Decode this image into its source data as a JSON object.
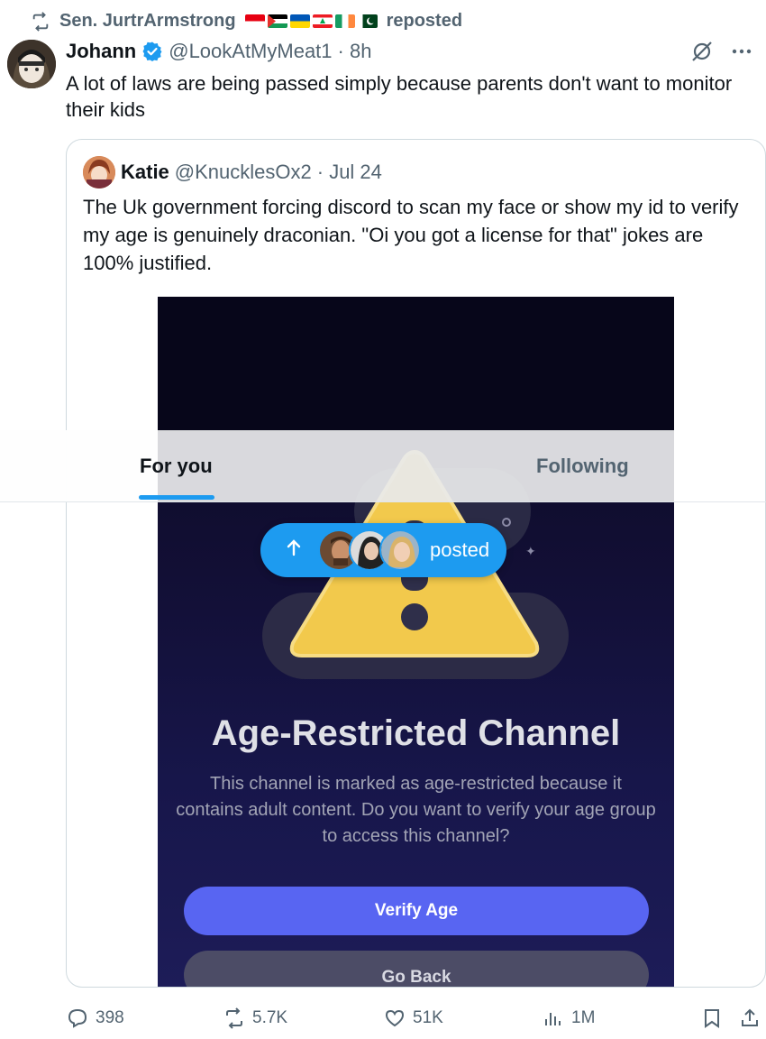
{
  "repost": {
    "by": "Sen. JurtrArmstrong",
    "suffix": "reposted"
  },
  "tweet": {
    "author_name": "Johann",
    "handle": "@LookAtMyMeat1",
    "time": "· 8h",
    "text": "A lot of laws are being passed simply because parents don't want to monitor their kids"
  },
  "quote": {
    "author_name": "Katie",
    "handle": "@KnucklesOx2",
    "time": "· Jul 24",
    "text": "The Uk government forcing discord to scan my face or show my id to verify my age is genuinely draconian. \"Oi you got a license for that\" jokes are 100% justified.",
    "image": {
      "title": "Age-Restricted Channel",
      "description": "This channel is marked as age-restricted because it contains adult content. Do you want to verify your age group to access this channel?",
      "verify_label": "Verify Age",
      "goback_label": "Go Back"
    }
  },
  "tabs": [
    {
      "label": "For you",
      "active": true
    },
    {
      "label": "Following",
      "active": false
    }
  ],
  "new_posts_pill": {
    "label": "posted"
  },
  "actions": {
    "replies": "398",
    "reposts": "5.7K",
    "likes": "51K",
    "views": "1M"
  },
  "colors": {
    "accent": "#1d9bf0",
    "secondary_text": "#536471",
    "discord_blurple": "#5865f2",
    "warning_yellow": "#f2c94c"
  },
  "icons": [
    "repost-icon",
    "verified-badge-icon",
    "grok-icon",
    "more-icon",
    "reply-icon",
    "like-icon",
    "views-icon",
    "bookmark-icon",
    "share-icon",
    "warning-triangle-icon",
    "arrow-up-icon"
  ]
}
